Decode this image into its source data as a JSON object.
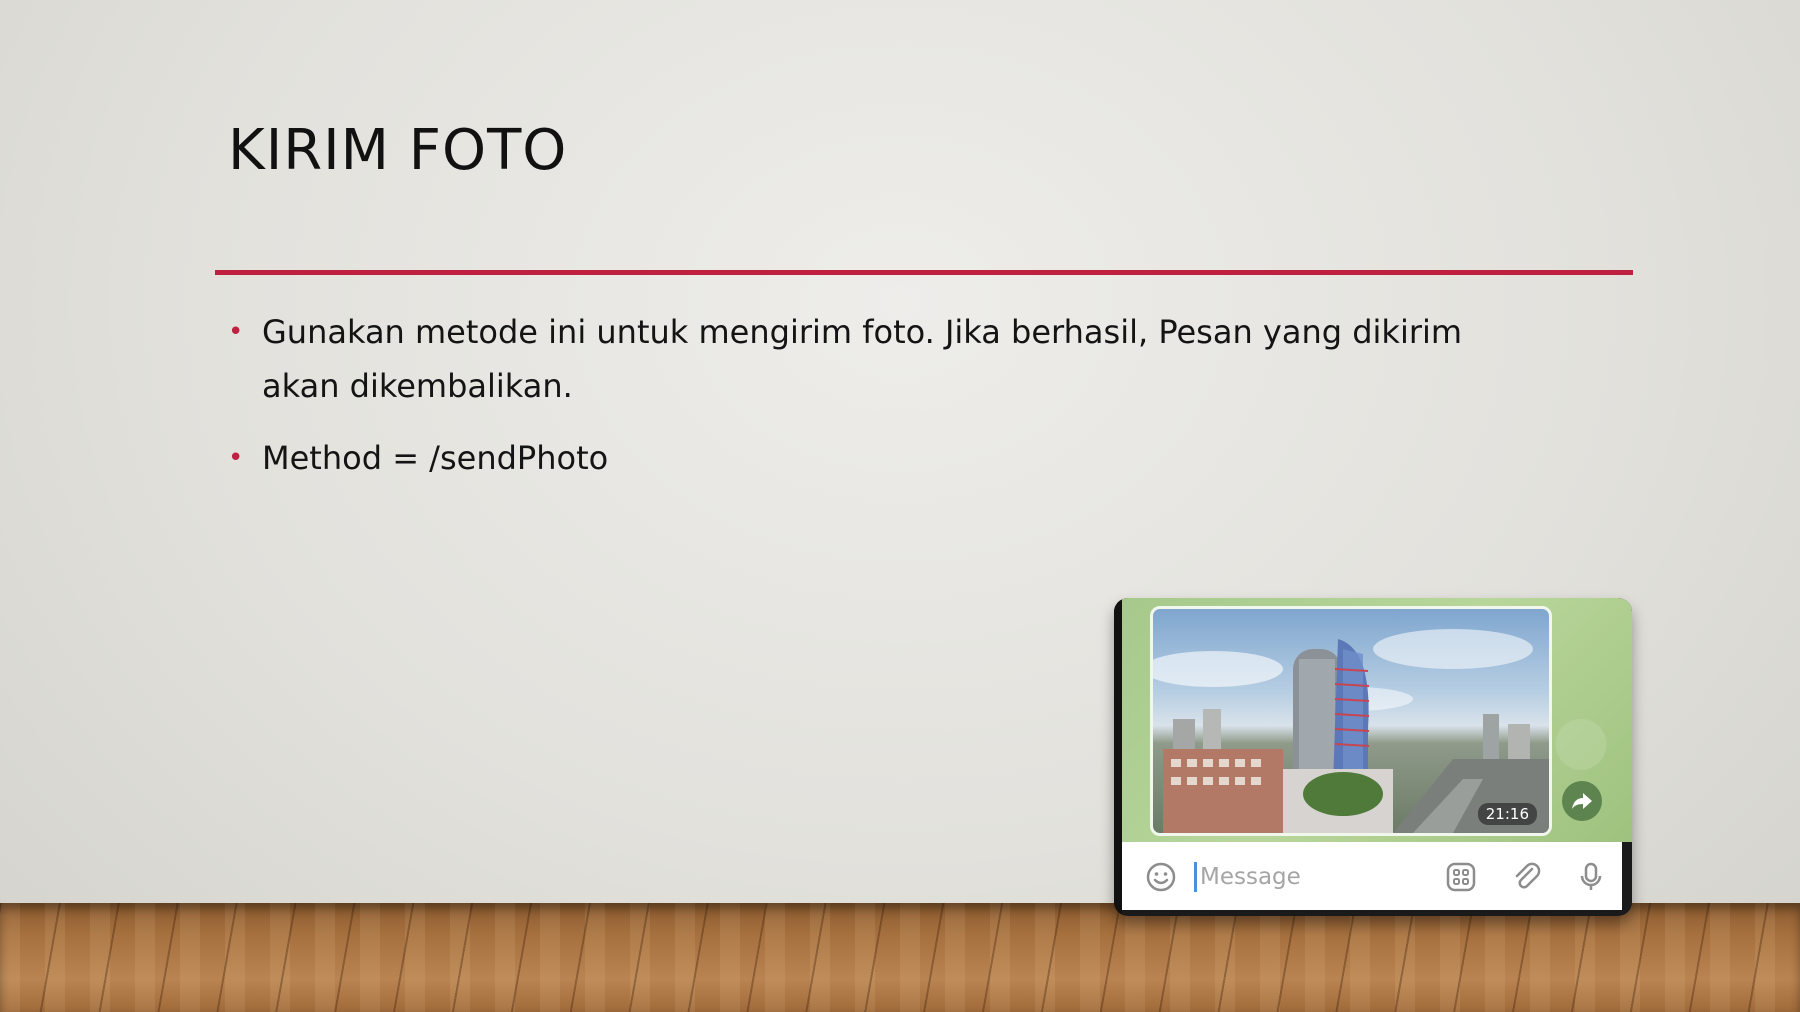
{
  "slide": {
    "title": "KIRIM FOTO",
    "accent_color": "#c0203f",
    "bullets": [
      "Gunakan metode ini untuk mengirim foto. Jika berhasil, Pesan yang dikirim akan dikembalikan.",
      "Method = /sendPhoto"
    ]
  },
  "telegram_screenshot": {
    "photo_time": "21:16",
    "message_placeholder": "Message",
    "icons": {
      "emoji": "emoji-icon",
      "sticker": "sticker-grid-icon",
      "attach": "paperclip-icon",
      "mic": "microphone-icon",
      "forward": "forward-arrow-icon"
    }
  }
}
